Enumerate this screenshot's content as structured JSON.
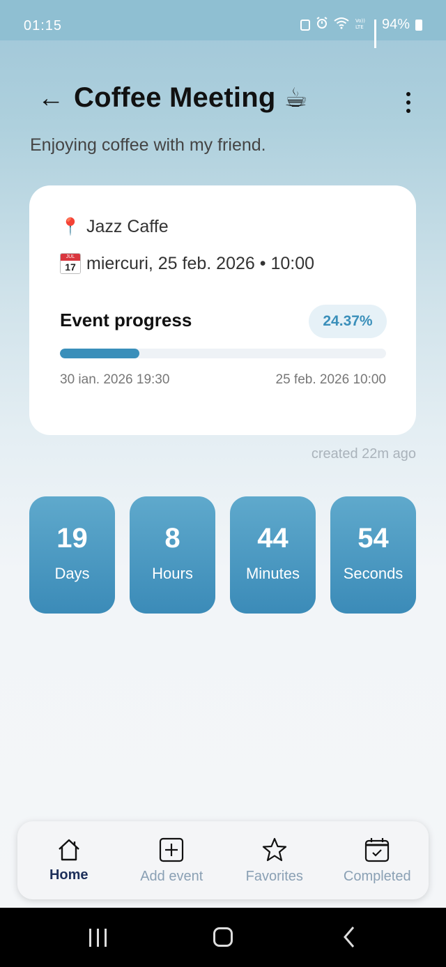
{
  "status_bar": {
    "time": "01:15",
    "battery": "94%"
  },
  "header": {
    "back_icon": "arrow-left-icon",
    "title": "Coffee Meeting",
    "title_emoji": "☕",
    "menu_icon": "kebab-menu-icon"
  },
  "subtitle": "Enjoying coffee with my friend.",
  "details": {
    "location_icon": "📍",
    "location": "Jazz Caffe",
    "calendar_icon_month": "JUL",
    "calendar_icon_day": "17",
    "datetime": "miercuri, 25 feb. 2026 • 10:00"
  },
  "progress": {
    "label": "Event progress",
    "percent_text": "24.37%",
    "percent": 24.37,
    "start": "30 ian. 2026 19:30",
    "end": "25 feb. 2026 10:00"
  },
  "created": "created 22m ago",
  "countdown": [
    {
      "value": "19",
      "label": "Days"
    },
    {
      "value": "8",
      "label": "Hours"
    },
    {
      "value": "44",
      "label": "Minutes"
    },
    {
      "value": "54",
      "label": "Seconds"
    }
  ],
  "nav": [
    {
      "label": "Home",
      "icon": "home-icon",
      "active": true
    },
    {
      "label": "Add event",
      "icon": "plus-square-icon",
      "active": false
    },
    {
      "label": "Favorites",
      "icon": "star-icon",
      "active": false
    },
    {
      "label": "Completed",
      "icon": "calendar-check-icon",
      "active": false
    }
  ],
  "colors": {
    "accent": "#3a8fba",
    "nav_active": "#1d2f5a",
    "nav_inactive": "#8aa0b4"
  }
}
